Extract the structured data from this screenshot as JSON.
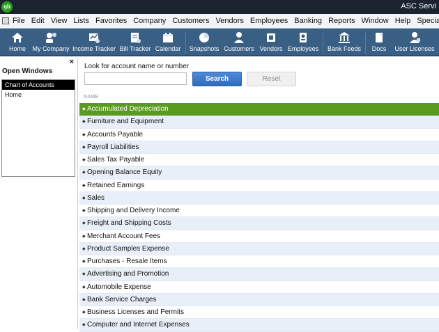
{
  "app": {
    "logo_text": "qb",
    "title": "ASC Servi"
  },
  "menubar": {
    "items": [
      "File",
      "Edit",
      "View",
      "Lists",
      "Favorites",
      "Company",
      "Customers",
      "Vendors",
      "Employees",
      "Banking",
      "Reports",
      "Window",
      "Help",
      "Special Offers"
    ]
  },
  "iconbar": {
    "items": [
      {
        "label": "Home",
        "icon": "home-icon"
      },
      {
        "label": "My Company",
        "icon": "my-company-icon"
      },
      {
        "label": "Income Tracker",
        "icon": "income-tracker-icon"
      },
      {
        "label": "Bill Tracker",
        "icon": "bill-tracker-icon"
      },
      {
        "label": "Calendar",
        "icon": "calendar-icon"
      },
      {
        "label": "Snapshots",
        "icon": "pie-chart-icon"
      },
      {
        "label": "Customers",
        "icon": "customer-icon"
      },
      {
        "label": "Vendors",
        "icon": "vendor-icon"
      },
      {
        "label": "Employees",
        "icon": "employee-icon"
      },
      {
        "label": "Bank Feeds",
        "icon": "bank-icon"
      },
      {
        "label": "Docs",
        "icon": "docs-icon"
      },
      {
        "label": "User Licenses",
        "icon": "user-licenses-icon"
      }
    ]
  },
  "open_windows": {
    "close_symbol": "×",
    "heading": "Open Windows",
    "items": [
      "Chart of Accounts",
      "Home"
    ],
    "active_index": 0
  },
  "search": {
    "label": "Look for account name or number",
    "value": "",
    "search_button": "Search",
    "reset_button": "Reset"
  },
  "accounts": {
    "column_header": "NAME",
    "bullet": "◆",
    "selected_index": 0,
    "rows": [
      "Accumulated Depreciation",
      "Furniture and Equipment",
      "Accounts Payable",
      "Payroll Liabilities",
      "Sales Tax Payable",
      "Opening Balance Equity",
      "Retained Earnings",
      "Sales",
      "Shipping and Delivery Income",
      "Freight and Shipping Costs",
      "Merchant Account Fees",
      "Product Samples Expense",
      "Purchases - Resale Items",
      "Advertising and Promotion",
      "Automobile Expense",
      "Bank Service Charges",
      "Business Licenses and Permits",
      "Computer and Internet Expenses"
    ]
  },
  "colors": {
    "title_bar": "#1b2230",
    "toolbar": "#3a5f85",
    "selected_row": "#5a9a1e",
    "search_button": "#2f6bbd",
    "alt_row": "#e9eff8"
  }
}
